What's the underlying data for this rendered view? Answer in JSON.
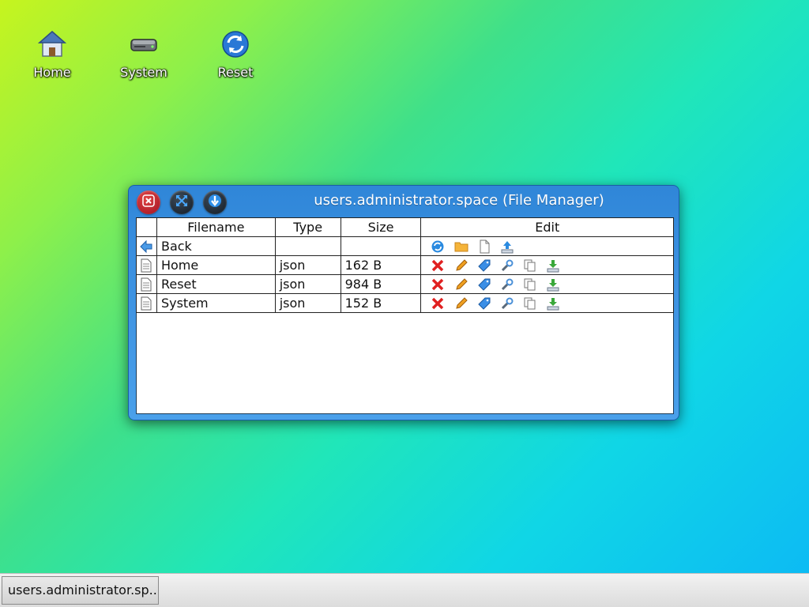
{
  "desktop": {
    "icons": [
      {
        "label": "Home",
        "icon": "home-icon"
      },
      {
        "label": "System",
        "icon": "drive-icon"
      },
      {
        "label": "Reset",
        "icon": "refresh-icon"
      }
    ]
  },
  "window": {
    "title": "users.administrator.space (File Manager)",
    "buttons": [
      "close-icon",
      "maximize-icon",
      "minimize-icon"
    ]
  },
  "table": {
    "headers": [
      "Filename",
      "Type",
      "Size",
      "Edit"
    ],
    "back_row": {
      "label": "Back",
      "icon": "back-arrow-icon",
      "actions": [
        "refresh-icon",
        "new-folder-icon",
        "new-file-icon",
        "upload-icon"
      ]
    },
    "rows": [
      {
        "name": "Home",
        "type": "json",
        "size": "162 B"
      },
      {
        "name": "Reset",
        "type": "json",
        "size": "984 B"
      },
      {
        "name": "System",
        "type": "json",
        "size": "152 B"
      }
    ],
    "row_actions": [
      "delete-icon",
      "rename-icon",
      "tag-icon",
      "settings-icon",
      "copy-icon",
      "download-icon"
    ]
  },
  "taskbar": {
    "task_label": "users.administrator.sp..."
  },
  "colors": {
    "window_title_bar": "#3a8fdf",
    "close_button": "#c0202e",
    "taskbar": "#e4e4e4"
  }
}
